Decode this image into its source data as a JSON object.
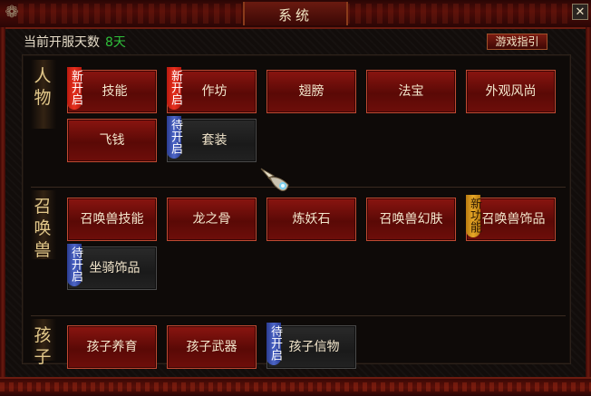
{
  "window": {
    "title": "系统",
    "close_label": "✕",
    "corner_icon": "swirl-icon"
  },
  "header": {
    "days_label": "当前开服天数",
    "days_value": "8天",
    "guide_button": "游戏指引"
  },
  "sections": [
    {
      "name": "人物",
      "buttons": [
        {
          "label": "技能",
          "tag": "新开启",
          "tag_color": "red",
          "enabled": true
        },
        {
          "label": "作坊",
          "tag": "新开启",
          "tag_color": "red",
          "enabled": true
        },
        {
          "label": "翅膀",
          "tag": "",
          "enabled": true
        },
        {
          "label": "法宝",
          "tag": "",
          "enabled": true
        },
        {
          "label": "外观风尚",
          "tag": "",
          "enabled": true
        },
        {
          "label": "飞钱",
          "tag": "",
          "enabled": true
        },
        {
          "label": "套装",
          "tag": "待开启",
          "tag_color": "blue",
          "enabled": false
        }
      ]
    },
    {
      "name": "召唤兽",
      "buttons": [
        {
          "label": "召唤兽技能",
          "tag": "",
          "enabled": true
        },
        {
          "label": "龙之骨",
          "tag": "",
          "enabled": true
        },
        {
          "label": "炼妖石",
          "tag": "",
          "enabled": true
        },
        {
          "label": "召唤兽幻肤",
          "tag": "",
          "enabled": true
        },
        {
          "label": "召唤兽饰品",
          "tag": "新功能",
          "tag_color": "gold",
          "enabled": true
        },
        {
          "label": "坐骑饰品",
          "tag": "待开启",
          "tag_color": "blue",
          "enabled": false
        }
      ]
    },
    {
      "name": "孩子",
      "buttons": [
        {
          "label": "孩子养育",
          "tag": "",
          "enabled": true
        },
        {
          "label": "孩子武器",
          "tag": "",
          "enabled": true
        },
        {
          "label": "孩子信物",
          "tag": "待开启",
          "tag_color": "blue",
          "enabled": false
        }
      ]
    }
  ]
}
